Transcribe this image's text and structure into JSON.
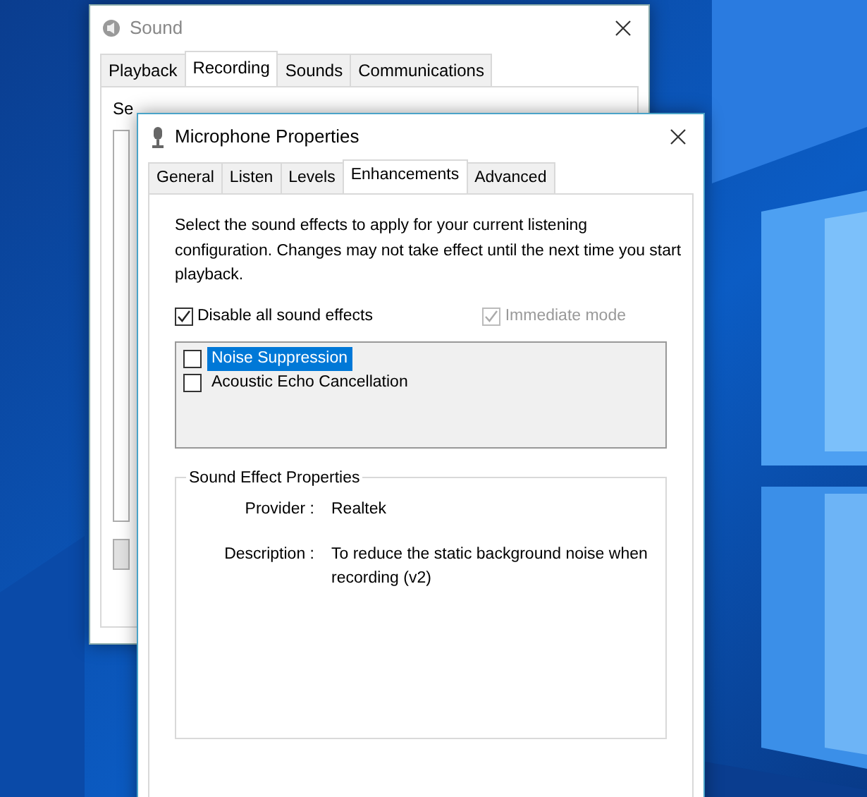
{
  "sound_window": {
    "title": "Sound",
    "tabs": [
      {
        "label": "Playback",
        "selected": false
      },
      {
        "label": "Recording",
        "selected": true
      },
      {
        "label": "Sounds",
        "selected": false
      },
      {
        "label": "Communications",
        "selected": false
      }
    ],
    "panel_text": "Se"
  },
  "properties_window": {
    "title": "Microphone Properties",
    "tabs": [
      {
        "label": "General",
        "selected": false
      },
      {
        "label": "Listen",
        "selected": false
      },
      {
        "label": "Levels",
        "selected": false
      },
      {
        "label": "Enhancements",
        "selected": true
      },
      {
        "label": "Advanced",
        "selected": false
      }
    ],
    "intro": "Select the sound effects to apply for your current listening configuration. Changes may not take effect until the next time you start playback.",
    "options": [
      {
        "label": "Disable all sound effects",
        "checked": true,
        "disabled": false
      },
      {
        "label": "Immediate mode",
        "checked": true,
        "disabled": true
      }
    ],
    "effects": [
      {
        "label": "Noise Suppression",
        "checked": false,
        "selected": true
      },
      {
        "label": "Acoustic Echo Cancellation",
        "checked": false,
        "selected": false
      }
    ],
    "group": {
      "title": "Sound Effect Properties",
      "fields": [
        {
          "label": "Provider :",
          "value": "Realtek"
        },
        {
          "label": "Description :",
          "value": "To reduce the static background noise when recording (v2)"
        }
      ]
    }
  }
}
